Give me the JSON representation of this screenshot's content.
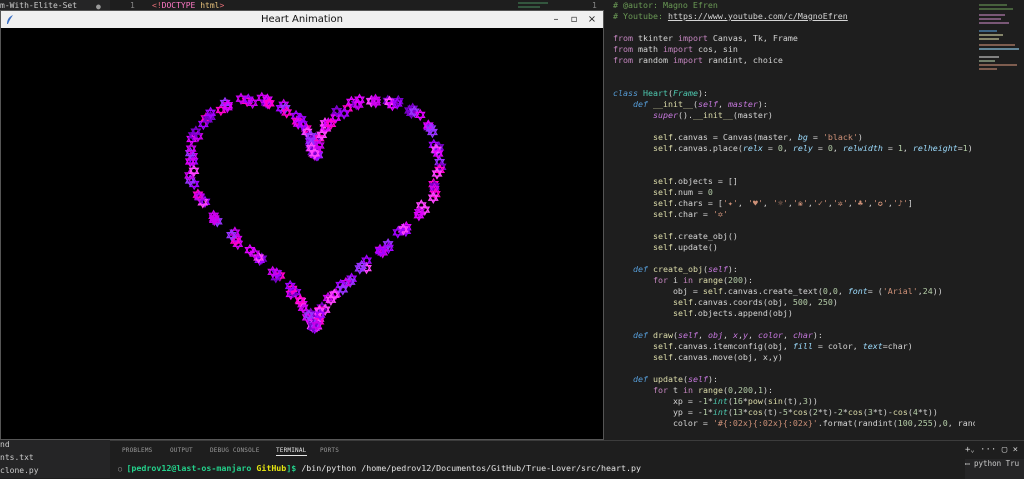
{
  "explorer": {
    "top_label": "m-With-Elite-Set",
    "files": [
      "nd",
      "nts.txt",
      "clone.py"
    ]
  },
  "html_editor": {
    "line_number": "1",
    "code_open": "<!",
    "code_doctype": "DOCTYPE",
    "code_html": "html",
    "code_close": ">"
  },
  "py_editor": {
    "line_number": "1",
    "lines": {
      "author": "# @autor: Magno Efren",
      "youtube_prefix": "# Youtube: ",
      "youtube_url": "https://www.youtube.com/c/MagnoEfren"
    }
  },
  "window": {
    "title": "Heart Animation",
    "minimize_glyph": "–",
    "maximize_glyph": "▫",
    "close_glyph": "×"
  },
  "heart": {
    "point_count": 200,
    "colors": [
      "#cc00ee",
      "#a300ff",
      "#ff44ff",
      "#7a00cc",
      "#e000ff",
      "#9933ff",
      "#ff00cc"
    ]
  },
  "panel": {
    "tabs": [
      "PROBLEMS",
      "OUTPUT",
      "DEBUG CONSOLE",
      "TERMINAL",
      "PORTS"
    ],
    "active_tab": "TERMINAL",
    "prompt_user": "[pedrov12@last-os-manjaro",
    "prompt_dir": "GitHub",
    "prompt_end": "]$ ",
    "command": "/bin/python /home/pedrov12/Documentos/GitHub/True-Lover/src/heart.py",
    "terminal_entry": "python",
    "terminal_entry_suffix": "Tru"
  },
  "colors": {
    "canvas_bg": "#000000",
    "editor_bg": "#1e1e1e",
    "prompt_green": "#23d18b",
    "prompt_yellow": "#e5e510"
  }
}
